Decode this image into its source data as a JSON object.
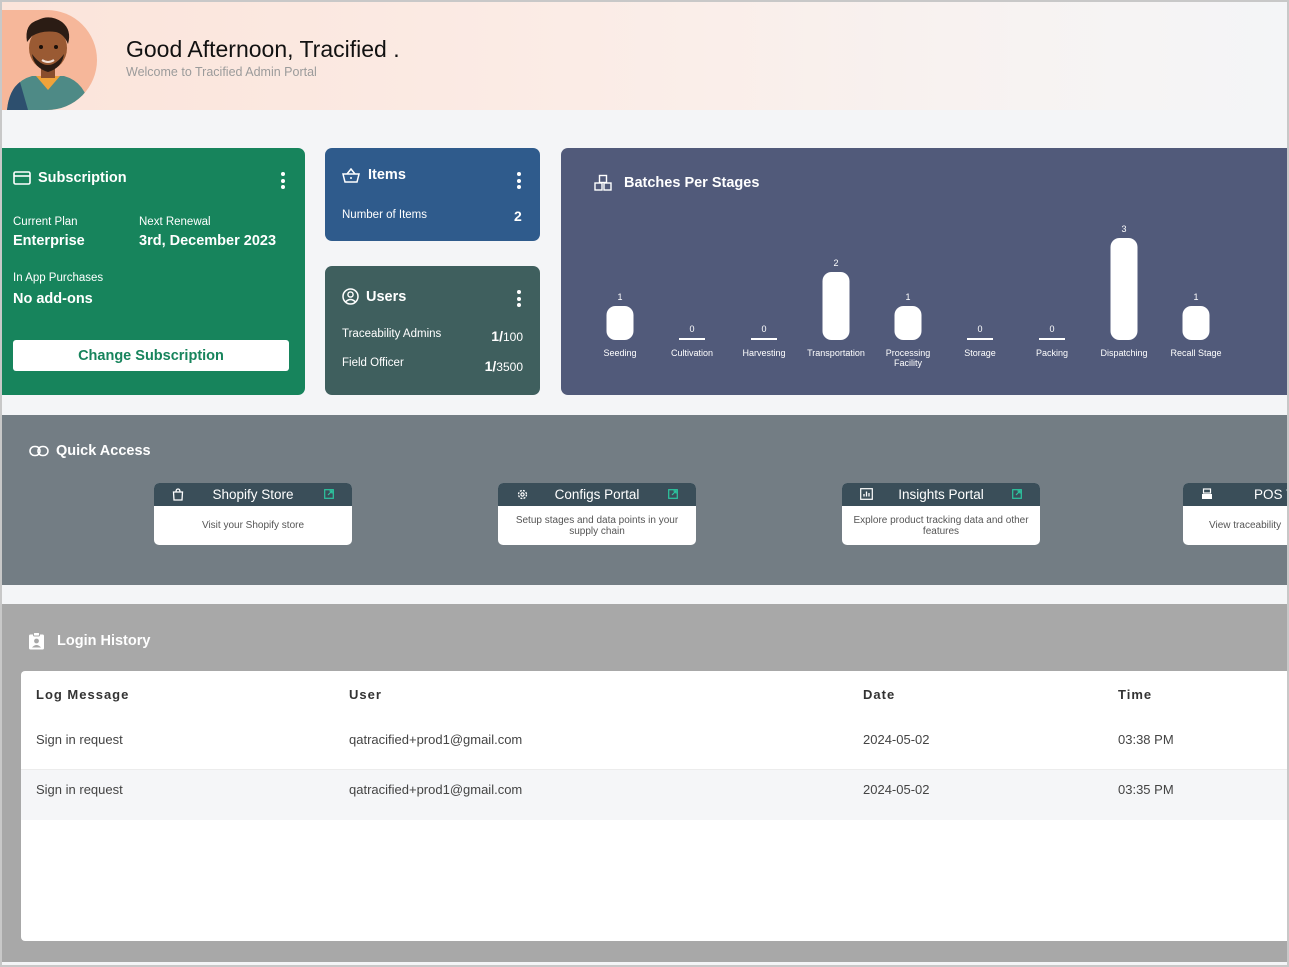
{
  "header": {
    "greeting": "Good Afternoon, Tracified .",
    "welcome": "Welcome to Tracified Admin Portal"
  },
  "subscription": {
    "title": "Subscription",
    "current_plan_label": "Current Plan",
    "current_plan": "Enterprise",
    "next_renewal_label": "Next Renewal",
    "next_renewal": "3rd, December 2023",
    "in_app_label": "In App Purchases",
    "in_app": "No add-ons",
    "button": "Change Subscription"
  },
  "items": {
    "title": "Items",
    "count_label": "Number of Items",
    "count": "2"
  },
  "users": {
    "title": "Users",
    "rows": [
      {
        "label": "Traceability Admins",
        "used": "1/",
        "limit": "100"
      },
      {
        "label": "Field Officer",
        "used": "1/",
        "limit": "3500"
      }
    ]
  },
  "batches": {
    "title": "Batches Per Stages"
  },
  "chart_data": {
    "type": "bar",
    "title": "Batches Per Stages",
    "categories": [
      "Seeding",
      "Cultivation",
      "Harvesting",
      "Transportation",
      "Processing Facility",
      "Storage",
      "Packing",
      "Dispatching",
      "Recall Stage"
    ],
    "values": [
      1,
      0,
      0,
      2,
      1,
      0,
      0,
      3,
      1
    ],
    "ylim": [
      0,
      3
    ],
    "grid": false
  },
  "quick_access": {
    "title": "Quick Access",
    "cards": [
      {
        "title": "Shopify Store",
        "desc": "Visit your Shopify store"
      },
      {
        "title": "Configs Portal",
        "desc": "Setup stages and data points in your supply chain"
      },
      {
        "title": "Insights Portal",
        "desc": "Explore product tracking data and other features"
      },
      {
        "title": "POS V",
        "desc": "View traceability"
      }
    ]
  },
  "login_history": {
    "title": "Login History",
    "columns": [
      "Log Message",
      "User",
      "Date",
      "Time"
    ],
    "rows": [
      [
        "Sign in request",
        "qatracified+prod1@gmail.com",
        "2024-05-02",
        "03:38 PM"
      ],
      [
        "Sign in request",
        "qatracified+prod1@gmail.com",
        "2024-05-02",
        "03:35 PM"
      ]
    ]
  },
  "colors": {
    "subscription": "#17845c",
    "items": "#2f5b8c",
    "users": "#3f5f5e",
    "batches": "#515a7a",
    "quick_access": "#737d84",
    "login_history": "#a8a8a8"
  }
}
